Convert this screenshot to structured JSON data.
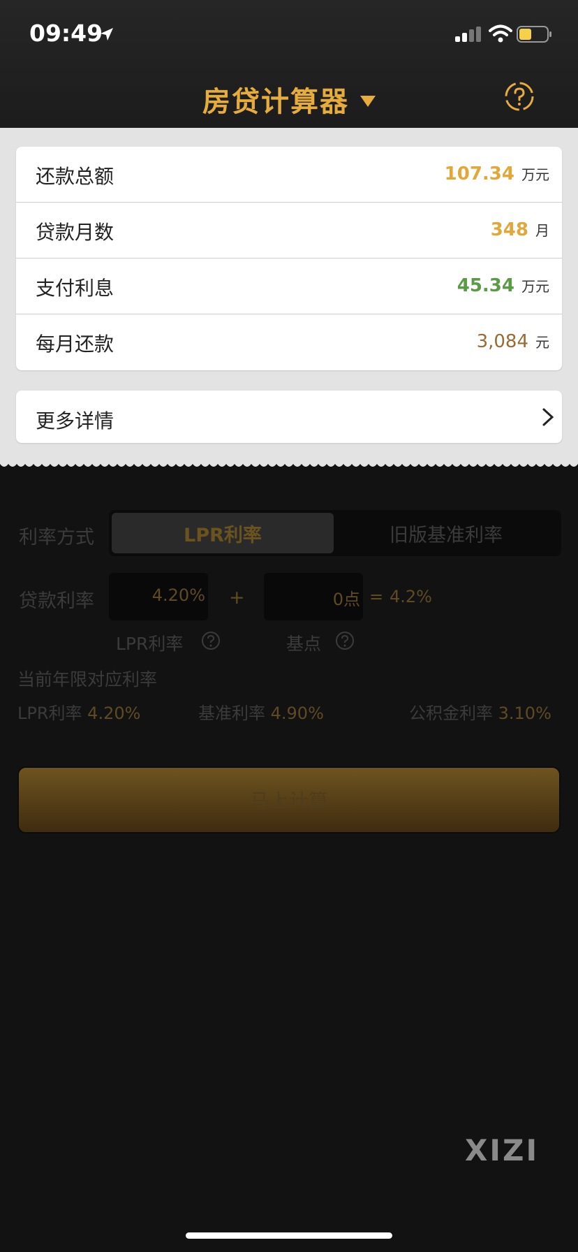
{
  "status_bar": {
    "time": "09:49"
  },
  "nav": {
    "title": "房贷计算器"
  },
  "results": [
    {
      "label": "还款总额",
      "value": "107.34",
      "unit": "万元",
      "color": "#e0a83a",
      "bold": true
    },
    {
      "label": "贷款月数",
      "value": "348",
      "unit": "月",
      "color": "#e0a83a",
      "bold": true
    },
    {
      "label": "支付利息",
      "value": "45.34",
      "unit": "万元",
      "color": "#5b9a46",
      "bold": true
    },
    {
      "label": "每月还款",
      "value": "3,084",
      "unit": "元",
      "color": "#9a6a34",
      "bold": false
    }
  ],
  "more_details": {
    "label": "更多详情"
  },
  "form": {
    "rate_method_label": "利率方式",
    "tab_lpr": "LPR利率",
    "tab_legacy": "旧版基准利率",
    "loan_rate_label": "贷款利率",
    "lpr_value": "4.20%",
    "plus_sign": "+",
    "basis_value": "0点",
    "equals_sign": "=",
    "result_rate": "4.2%",
    "lpr_caption": "LPR利率",
    "basis_caption": "基点",
    "current_rates_title": "当前年限对应利率",
    "lpr_rate_label": "LPR利率",
    "lpr_rate_value": "4.20%",
    "benchmark_rate_label": "基准利率",
    "benchmark_rate_value": "4.90%",
    "fund_rate_label": "公积金利率",
    "fund_rate_value": "3.10%",
    "calc_button": "马上计算"
  },
  "watermark": "XIZI",
  "colors": {
    "accent_gold": "#e6ac3c",
    "interest_green": "#5b9a46"
  }
}
